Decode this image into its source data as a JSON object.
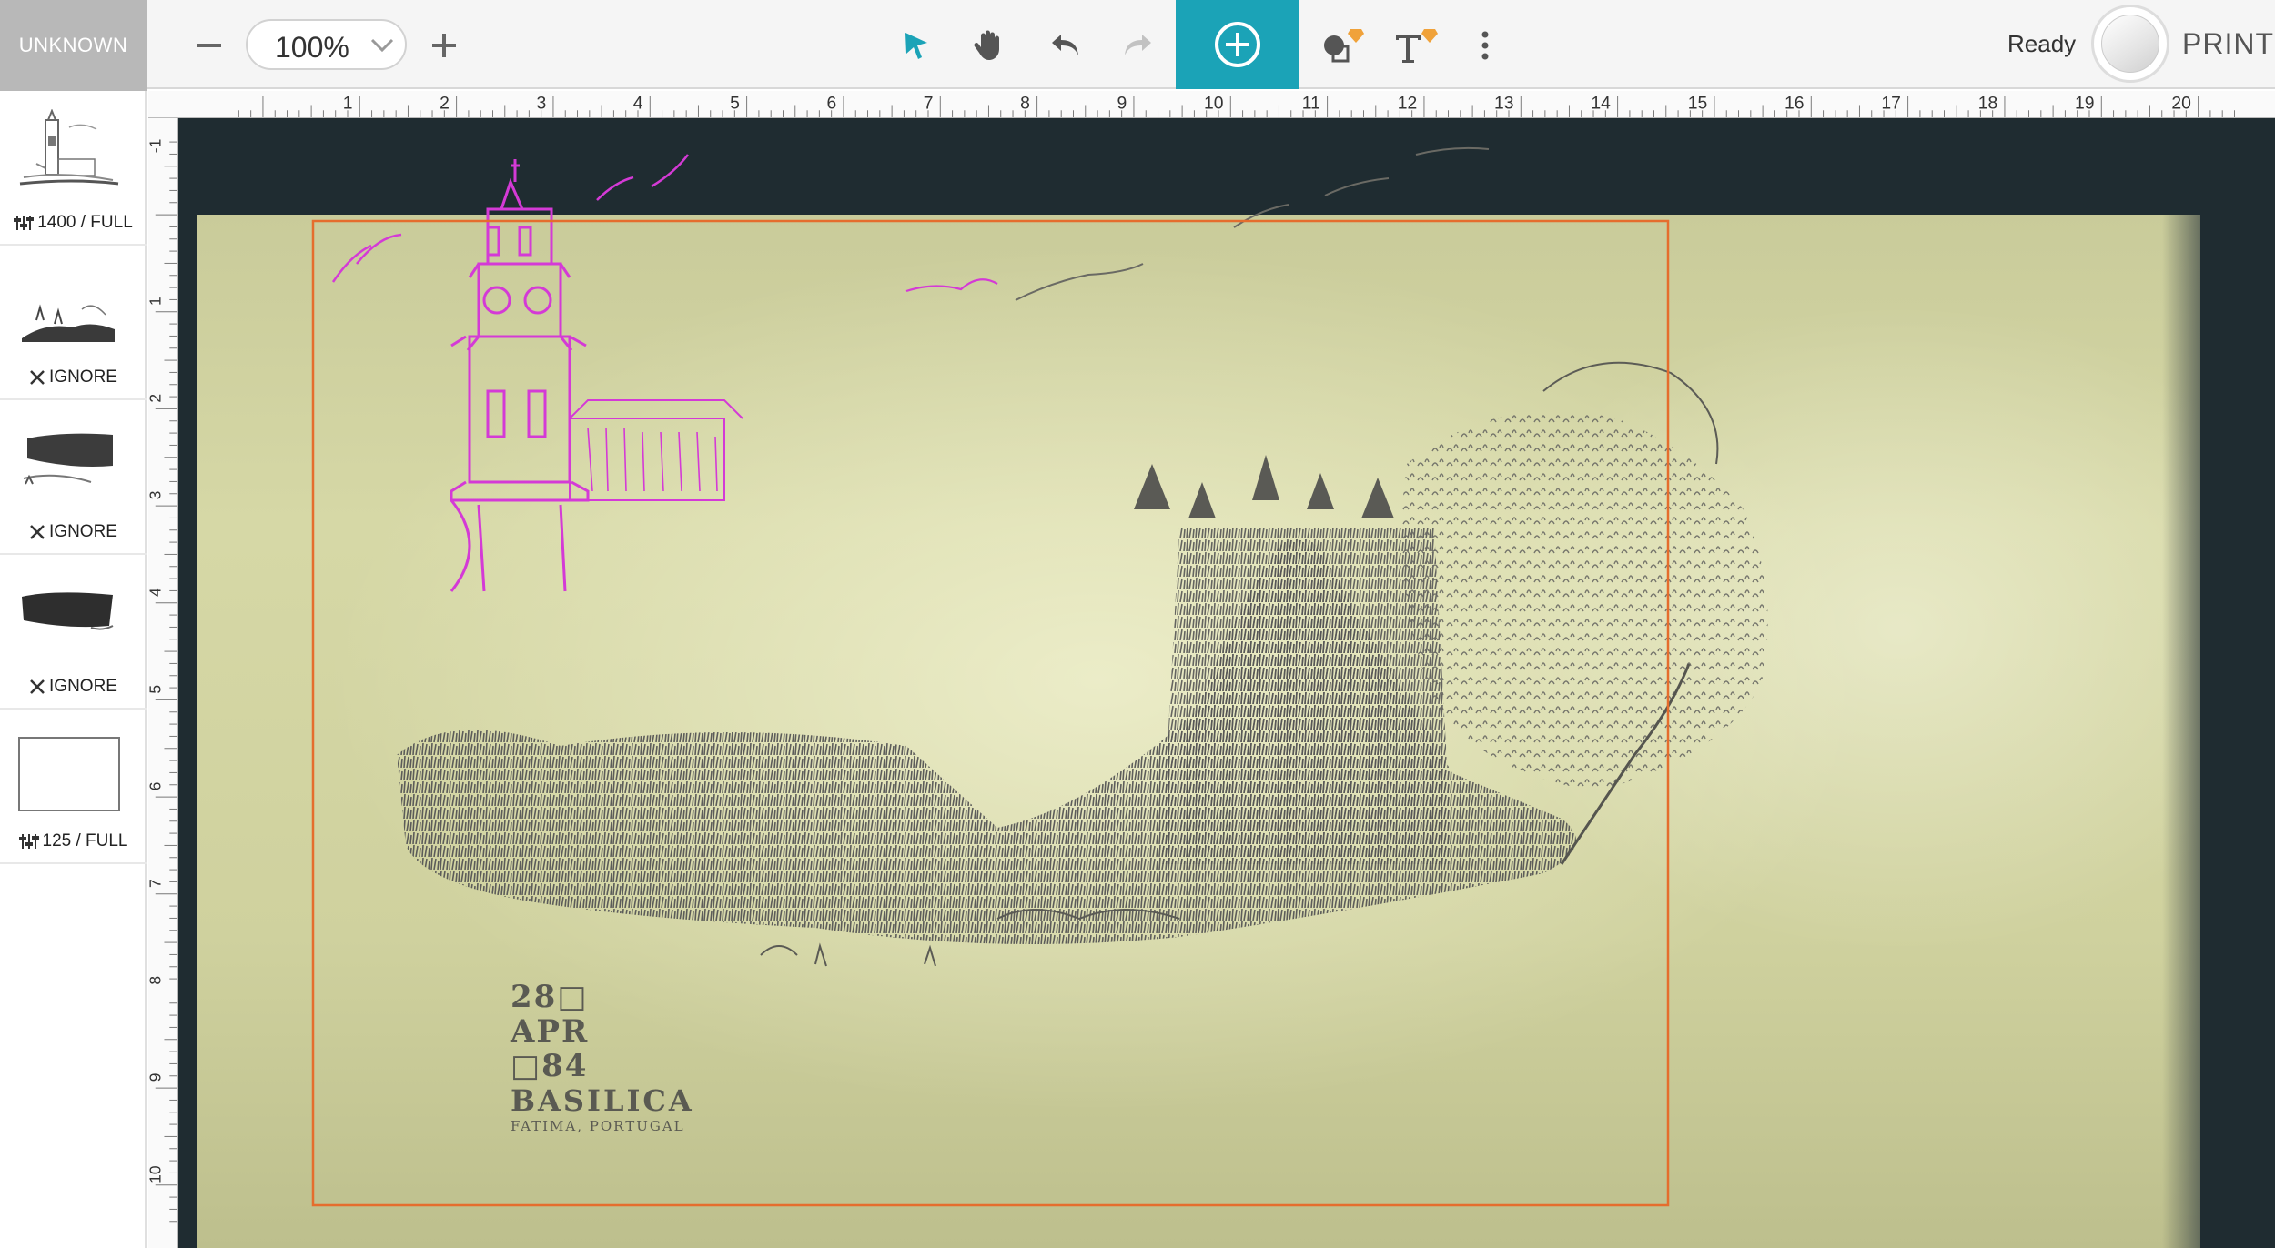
{
  "toolbar": {
    "device_name": "UNKNOWN",
    "zoom": "100%",
    "status": "Ready",
    "print_label": "PRINT",
    "accent_color": "#1ba3b7",
    "premium_badge_color": "#f0a23a",
    "icons": [
      "minus-icon",
      "chevron-down-icon",
      "plus-icon",
      "cursor-icon",
      "hand-icon",
      "undo-icon",
      "redo-icon",
      "plus-circle-icon",
      "shapes-icon",
      "text-icon",
      "more-vertical-icon"
    ]
  },
  "sidebar": {
    "layers": [
      {
        "label": "1400 / FULL",
        "icon": "settings-sliders-icon"
      },
      {
        "label": "IGNORE",
        "icon": "close-icon"
      },
      {
        "label": "IGNORE",
        "icon": "close-icon"
      },
      {
        "label": "IGNORE",
        "icon": "close-icon"
      },
      {
        "label": "125 / FULL",
        "icon": "settings-sliders-icon"
      }
    ]
  },
  "rulers": {
    "horizontal": [
      "1",
      "2",
      "3",
      "4",
      "5",
      "6",
      "7",
      "8",
      "9",
      "10",
      "11",
      "12",
      "13",
      "14",
      "15",
      "16",
      "17",
      "18",
      "19",
      "20"
    ],
    "vertical": [
      "-1",
      "1",
      "2",
      "3",
      "4",
      "5",
      "6",
      "7",
      "8",
      "9",
      "10"
    ]
  },
  "artwork": {
    "line1": "28□",
    "line2": "APR",
    "line3": "□84",
    "line4": "BASILICA",
    "line5": "FATIMA, PORTUGAL",
    "highlight_color": "#d43ad6",
    "border_color": "#e56d2d"
  }
}
